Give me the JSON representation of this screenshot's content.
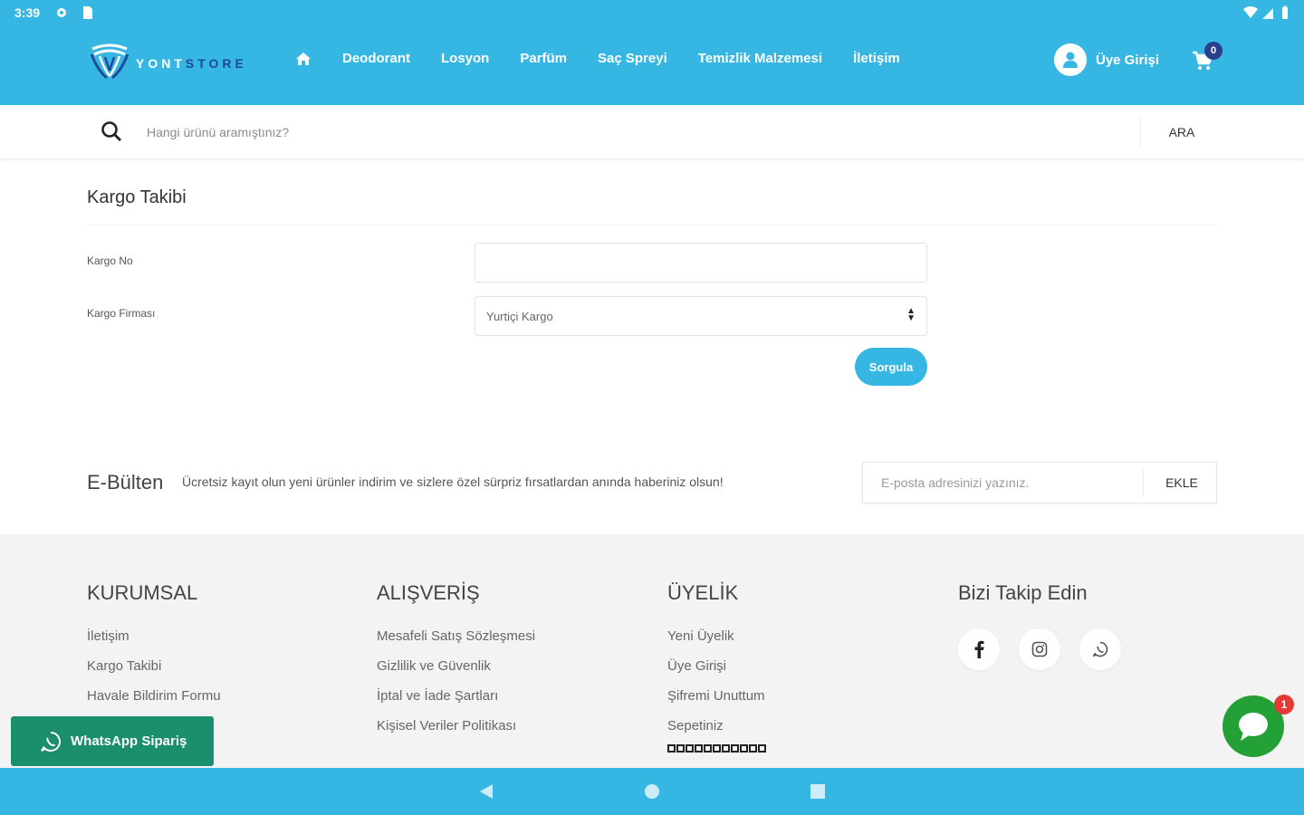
{
  "status_bar": {
    "time": "3:39"
  },
  "brand": {
    "name_part1": "YONT",
    "name_part2": "STORE"
  },
  "nav": {
    "items": [
      "Deodorant",
      "Losyon",
      "Parfüm",
      "Saç Spreyi",
      "Temizlik Malzemesi",
      "İletişim"
    ],
    "user_label": "Üye Girişi",
    "cart_count": "0"
  },
  "search": {
    "placeholder": "Hangi ürünü aramıştınız?",
    "button": "ARA"
  },
  "form": {
    "title": "Kargo Takibi",
    "tracking_label": "Kargo No",
    "tracking_value": "",
    "company_label": "Kargo Firması",
    "company_selected": "Yurtiçi Kargo",
    "submit": "Sorgula"
  },
  "newsletter": {
    "title": "E-Bülten",
    "description": "Ücretsiz kayıt olun yeni ürünler indirim ve sizlere özel sürpriz fırsatlardan anında haberiniz olsun!",
    "placeholder": "E-posta adresinizi yazınız.",
    "button": "EKLE"
  },
  "footer": {
    "kurumsal": {
      "title": "KURUMSAL",
      "links": [
        "İletişim",
        "Kargo Takibi",
        "Havale Bildirim Formu"
      ]
    },
    "alisveris": {
      "title": "ALIŞVERİŞ",
      "links": [
        "Mesafeli Satış Sözleşmesi",
        "Gizlilik ve Güvenlik",
        "İptal ve İade Şartları",
        "Kişisel Veriler Politikası"
      ]
    },
    "uyelik": {
      "title": "ÜYELİK",
      "links": [
        "Yeni Üyelik",
        "Üye Girişi",
        "Şifremi Unuttum",
        "Sepetiniz"
      ]
    },
    "social": {
      "title": "Bizi Takip Edin",
      "icons": [
        "facebook-icon",
        "instagram-icon",
        "whatsapp-icon"
      ]
    }
  },
  "whatsapp": {
    "label": "WhatsApp Sipariş"
  },
  "chat": {
    "badge": "1"
  },
  "colors": {
    "primary": "#36b7e3",
    "whatsapp": "#1b8e6e",
    "chat": "#23a137",
    "badge": "#e53935",
    "cart_badge": "#2a3f8e"
  }
}
